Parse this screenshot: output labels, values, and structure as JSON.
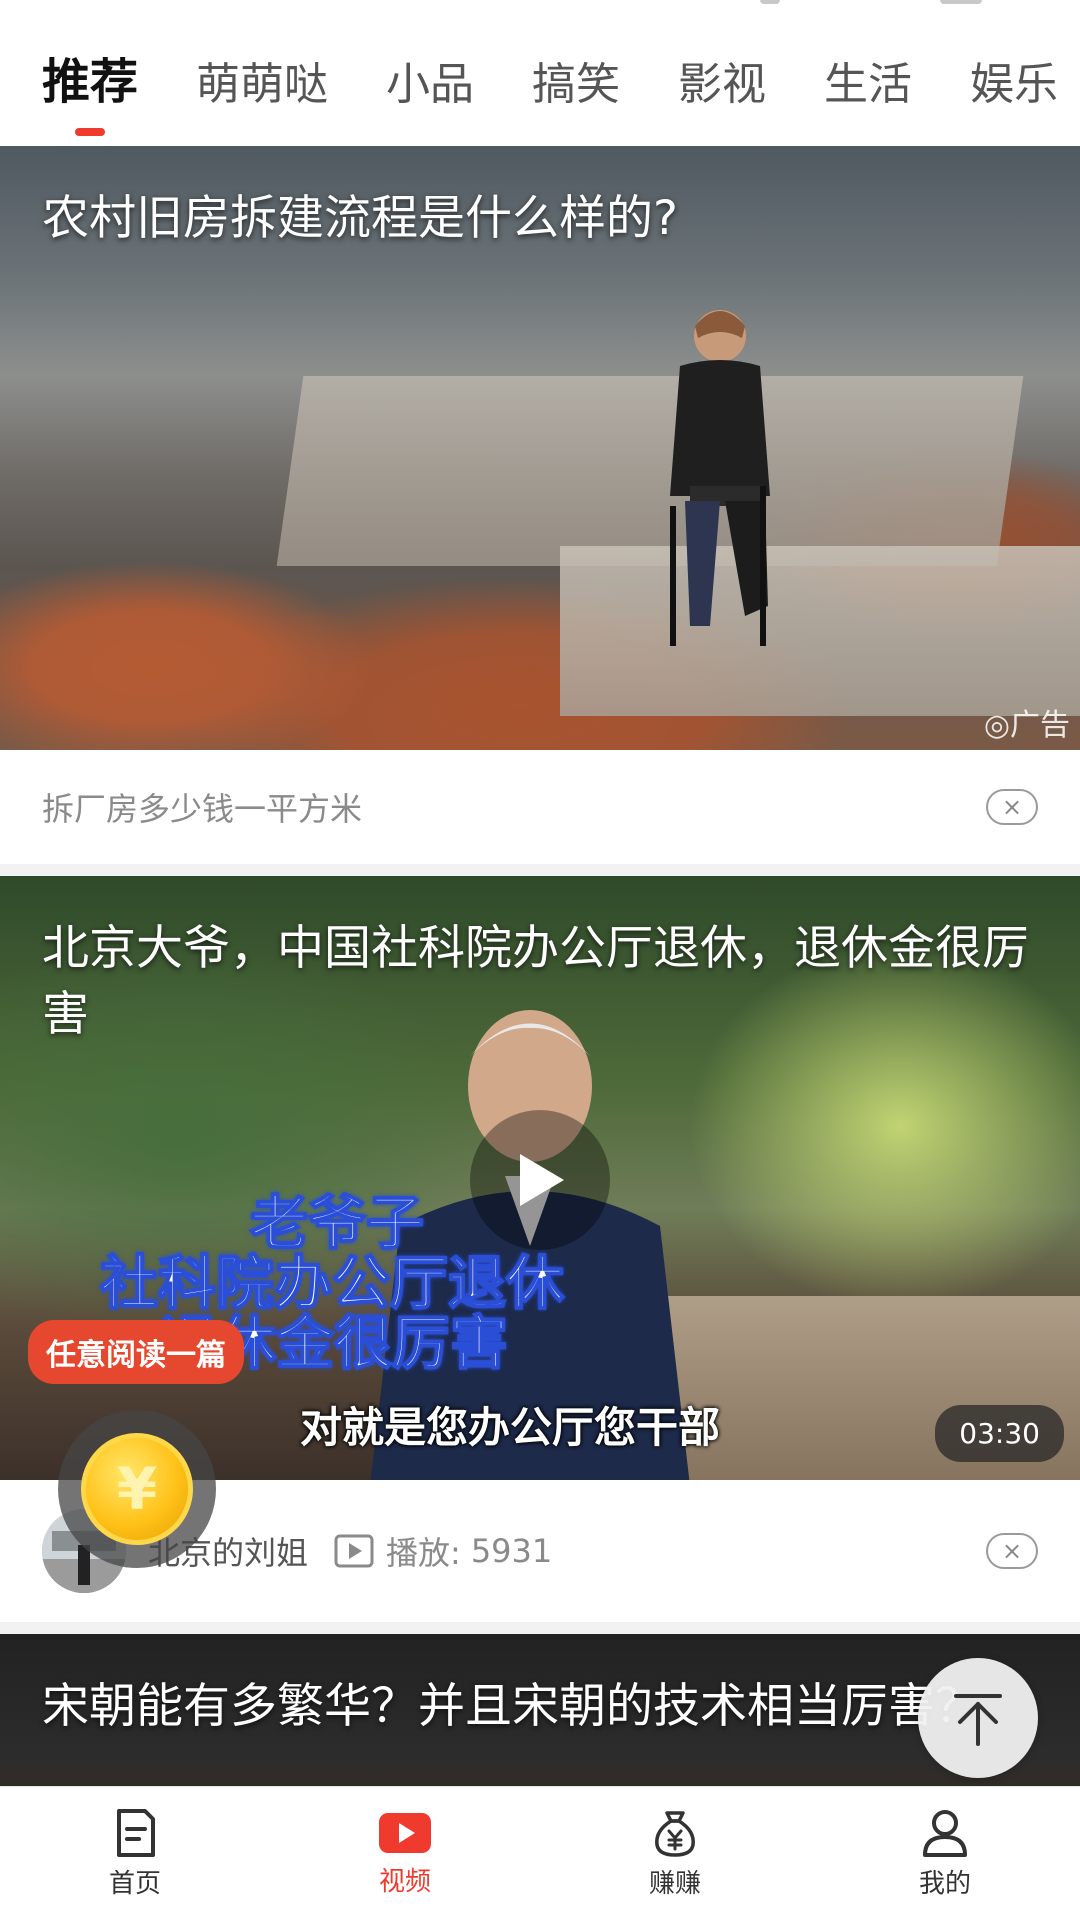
{
  "tabs": [
    "推荐",
    "萌萌哒",
    "小品",
    "搞笑",
    "影视",
    "生活",
    "娱乐"
  ],
  "active_tab_index": 0,
  "feed": [
    {
      "title": "农村旧房拆建流程是什么样的?",
      "ad_label": "广告",
      "meta_text": "拆厂房多少钱一平方米",
      "close_label": "×"
    },
    {
      "title": "北京大爷，中国社科院办公厅退休，退休金很厉害",
      "caption_lines": [
        "老爷子",
        "社科院办公厅退休",
        "退休金很厉害"
      ],
      "sub_caption": "对就是您办公厅您干部",
      "read_badge": "任意阅读一篇",
      "duration": "03:30",
      "author": "北京的刘姐",
      "play_label": "播放:",
      "play_count": "5931",
      "close_label": "×"
    },
    {
      "title": "宋朝能有多繁华？并且宋朝的技术相当厉害？"
    }
  ],
  "coin_symbol": "¥",
  "bottom_nav": [
    {
      "label": "首页",
      "icon": "home-doc-icon",
      "active": false
    },
    {
      "label": "视频",
      "icon": "video-play-icon",
      "active": true
    },
    {
      "label": "赚赚",
      "icon": "money-bag-icon",
      "active": false
    },
    {
      "label": "我的",
      "icon": "user-icon",
      "active": false
    }
  ],
  "colors": {
    "accent": "#f03a2e",
    "badge": "#e5482f"
  }
}
